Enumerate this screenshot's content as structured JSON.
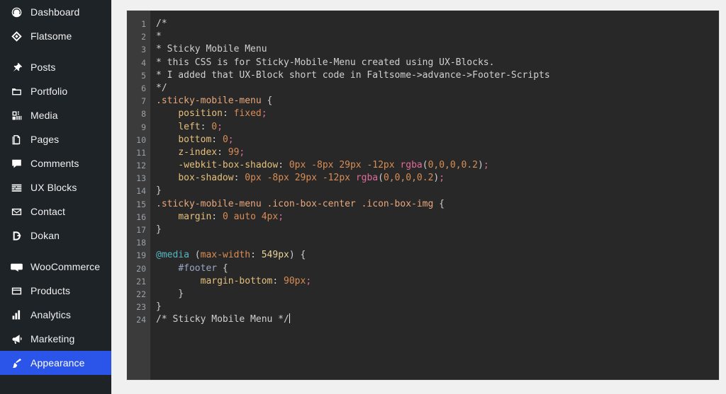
{
  "sidebar": {
    "items": [
      {
        "label": "Dashboard",
        "icon": "dashboard-gauge-icon",
        "current": false,
        "sep_after": false
      },
      {
        "label": "Flatsome",
        "icon": "flatsome-diamond-icon",
        "current": false,
        "sep_after": true
      },
      {
        "label": "Posts",
        "icon": "pin-icon",
        "current": false,
        "sep_after": false
      },
      {
        "label": "Portfolio",
        "icon": "folder-icon",
        "current": false,
        "sep_after": false
      },
      {
        "label": "Media",
        "icon": "media-icon",
        "current": false,
        "sep_after": false
      },
      {
        "label": "Pages",
        "icon": "pages-icon",
        "current": false,
        "sep_after": false
      },
      {
        "label": "Comments",
        "icon": "comment-bubble-icon",
        "current": false,
        "sep_after": false
      },
      {
        "label": "UX Blocks",
        "icon": "ux-blocks-icon",
        "current": false,
        "sep_after": false
      },
      {
        "label": "Contact",
        "icon": "envelope-icon",
        "current": false,
        "sep_after": false
      },
      {
        "label": "Dokan",
        "icon": "dokan-d-icon",
        "current": false,
        "sep_after": true
      },
      {
        "label": "WooCommerce",
        "icon": "woocommerce-icon",
        "current": false,
        "sep_after": false
      },
      {
        "label": "Products",
        "icon": "products-box-icon",
        "current": false,
        "sep_after": false
      },
      {
        "label": "Analytics",
        "icon": "analytics-bars-icon",
        "current": false,
        "sep_after": false
      },
      {
        "label": "Marketing",
        "icon": "megaphone-icon",
        "current": false,
        "sep_after": false
      },
      {
        "label": "Appearance",
        "icon": "paintbrush-icon",
        "current": true,
        "sep_after": false
      }
    ],
    "colors": {
      "background": "#1d2327",
      "text": "#f0f0f1",
      "current_background": "#2b55e8",
      "current_text": "#ffffff"
    }
  },
  "editor": {
    "colors": {
      "background": "#282828",
      "gutter_background": "#3b3b3b",
      "gutter_text": "#9aa0a6",
      "comment": "#d0d0d0",
      "selector": "#e8a87c",
      "property": "#e5c07b",
      "value": "#d98d55",
      "function": "#e06c9a",
      "at_rule": "#56b6c2",
      "id_selector": "#9aa7c4"
    },
    "line_numbers": [
      1,
      2,
      3,
      4,
      5,
      6,
      7,
      8,
      9,
      10,
      11,
      12,
      13,
      14,
      15,
      16,
      17,
      18,
      19,
      20,
      21,
      22,
      23,
      24
    ],
    "code_text": "/*\n*\n* Sticky Mobile Menu\n* this CSS is for Sticky-Mobile-Menu created using UX-Blocks.\n* I added that UX-Block short code in Faltsome->advance->Footer-Scripts\n*/\n.sticky-mobile-menu {\n    position: fixed;\n    left: 0;\n    bottom: 0;\n    z-index: 99;\n    -webkit-box-shadow: 0px -8px 29px -12px rgba(0,0,0,0.2);\n    box-shadow: 0px -8px 29px -12px rgba(0,0,0,0.2);\n}\n.sticky-mobile-menu .icon-box-center .icon-box-img {\n    margin: 0 auto 4px;\n}\n\n@media (max-width: 549px) {\n    #footer {\n        margin-bottom: 90px;\n    }\n}\n/* Sticky Mobile Menu */",
    "lines": [
      {
        "n": 1,
        "tokens": [
          {
            "t": "com",
            "s": "/*"
          }
        ]
      },
      {
        "n": 2,
        "tokens": [
          {
            "t": "com",
            "s": "*"
          }
        ]
      },
      {
        "n": 3,
        "tokens": [
          {
            "t": "com",
            "s": "* Sticky Mobile Menu"
          }
        ]
      },
      {
        "n": 4,
        "tokens": [
          {
            "t": "com",
            "s": "* this CSS is for Sticky-Mobile-Menu created using UX-Blocks."
          }
        ]
      },
      {
        "n": 5,
        "tokens": [
          {
            "t": "com",
            "s": "* I added that UX-Block short code in Faltsome->advance->Footer-Scripts"
          }
        ]
      },
      {
        "n": 6,
        "tokens": [
          {
            "t": "com",
            "s": "*/"
          }
        ]
      },
      {
        "n": 7,
        "tokens": [
          {
            "t": "sel",
            "s": ".sticky-mobile-menu"
          },
          {
            "t": "punc",
            "s": " {"
          }
        ]
      },
      {
        "n": 8,
        "tokens": [
          {
            "t": "punc",
            "s": "    "
          },
          {
            "t": "prop",
            "s": "position"
          },
          {
            "t": "punc",
            "s": ": "
          },
          {
            "t": "val",
            "s": "fixed"
          },
          {
            "t": "fn",
            "s": ";"
          }
        ]
      },
      {
        "n": 9,
        "tokens": [
          {
            "t": "punc",
            "s": "    "
          },
          {
            "t": "prop",
            "s": "left"
          },
          {
            "t": "punc",
            "s": ": "
          },
          {
            "t": "num",
            "s": "0"
          },
          {
            "t": "fn",
            "s": ";"
          }
        ]
      },
      {
        "n": 10,
        "tokens": [
          {
            "t": "punc",
            "s": "    "
          },
          {
            "t": "prop",
            "s": "bottom"
          },
          {
            "t": "punc",
            "s": ": "
          },
          {
            "t": "num",
            "s": "0"
          },
          {
            "t": "fn",
            "s": ";"
          }
        ]
      },
      {
        "n": 11,
        "tokens": [
          {
            "t": "punc",
            "s": "    "
          },
          {
            "t": "prop",
            "s": "z-index"
          },
          {
            "t": "punc",
            "s": ": "
          },
          {
            "t": "num",
            "s": "99"
          },
          {
            "t": "fn",
            "s": ";"
          }
        ]
      },
      {
        "n": 12,
        "tokens": [
          {
            "t": "punc",
            "s": "    "
          },
          {
            "t": "prop",
            "s": "-webkit-box-shadow"
          },
          {
            "t": "punc",
            "s": ": "
          },
          {
            "t": "num",
            "s": "0px"
          },
          {
            "t": "punc",
            "s": " "
          },
          {
            "t": "num",
            "s": "-8px"
          },
          {
            "t": "punc",
            "s": " "
          },
          {
            "t": "num",
            "s": "29px"
          },
          {
            "t": "punc",
            "s": " "
          },
          {
            "t": "num",
            "s": "-12px"
          },
          {
            "t": "punc",
            "s": " "
          },
          {
            "t": "fn",
            "s": "rgba"
          },
          {
            "t": "punc",
            "s": "("
          },
          {
            "t": "num",
            "s": "0,0,0,0.2"
          },
          {
            "t": "punc",
            "s": ")"
          },
          {
            "t": "fn",
            "s": ";"
          }
        ]
      },
      {
        "n": 13,
        "tokens": [
          {
            "t": "punc",
            "s": "    "
          },
          {
            "t": "prop",
            "s": "box-shadow"
          },
          {
            "t": "punc",
            "s": ": "
          },
          {
            "t": "num",
            "s": "0px"
          },
          {
            "t": "punc",
            "s": " "
          },
          {
            "t": "num",
            "s": "-8px"
          },
          {
            "t": "punc",
            "s": " "
          },
          {
            "t": "num",
            "s": "29px"
          },
          {
            "t": "punc",
            "s": " "
          },
          {
            "t": "num",
            "s": "-12px"
          },
          {
            "t": "punc",
            "s": " "
          },
          {
            "t": "fn",
            "s": "rgba"
          },
          {
            "t": "punc",
            "s": "("
          },
          {
            "t": "num",
            "s": "0,0,0,0.2"
          },
          {
            "t": "punc",
            "s": ")"
          },
          {
            "t": "fn",
            "s": ";"
          }
        ]
      },
      {
        "n": 14,
        "tokens": [
          {
            "t": "brace",
            "s": "}"
          }
        ]
      },
      {
        "n": 15,
        "tokens": [
          {
            "t": "sel",
            "s": ".sticky-mobile-menu .icon-box-center .icon-box-img"
          },
          {
            "t": "punc",
            "s": " {"
          }
        ]
      },
      {
        "n": 16,
        "tokens": [
          {
            "t": "punc",
            "s": "    "
          },
          {
            "t": "prop",
            "s": "margin"
          },
          {
            "t": "punc",
            "s": ": "
          },
          {
            "t": "num",
            "s": "0"
          },
          {
            "t": "punc",
            "s": " "
          },
          {
            "t": "val",
            "s": "auto"
          },
          {
            "t": "punc",
            "s": " "
          },
          {
            "t": "num",
            "s": "4px"
          },
          {
            "t": "fn",
            "s": ";"
          }
        ]
      },
      {
        "n": 17,
        "tokens": [
          {
            "t": "brace",
            "s": "}"
          }
        ]
      },
      {
        "n": 18,
        "tokens": []
      },
      {
        "n": 19,
        "tokens": [
          {
            "t": "at",
            "s": "@media"
          },
          {
            "t": "punc",
            "s": " ("
          },
          {
            "t": "val",
            "s": "max-width"
          },
          {
            "t": "punc",
            "s": ": "
          },
          {
            "t": "unit",
            "s": "549px"
          },
          {
            "t": "punc",
            "s": ") {"
          }
        ]
      },
      {
        "n": 20,
        "tokens": [
          {
            "t": "punc",
            "s": "    "
          },
          {
            "t": "id",
            "s": "#footer"
          },
          {
            "t": "punc",
            "s": " {"
          }
        ]
      },
      {
        "n": 21,
        "tokens": [
          {
            "t": "punc",
            "s": "        "
          },
          {
            "t": "prop",
            "s": "margin-bottom"
          },
          {
            "t": "punc",
            "s": ": "
          },
          {
            "t": "num",
            "s": "90px"
          },
          {
            "t": "fn",
            "s": ";"
          }
        ]
      },
      {
        "n": 22,
        "tokens": [
          {
            "t": "punc",
            "s": "    }"
          }
        ]
      },
      {
        "n": 23,
        "tokens": [
          {
            "t": "brace",
            "s": "}"
          }
        ]
      },
      {
        "n": 24,
        "tokens": [
          {
            "t": "com",
            "s": "/* Sticky Mobile Menu */"
          },
          {
            "t": "caret",
            "s": ""
          }
        ]
      }
    ]
  }
}
